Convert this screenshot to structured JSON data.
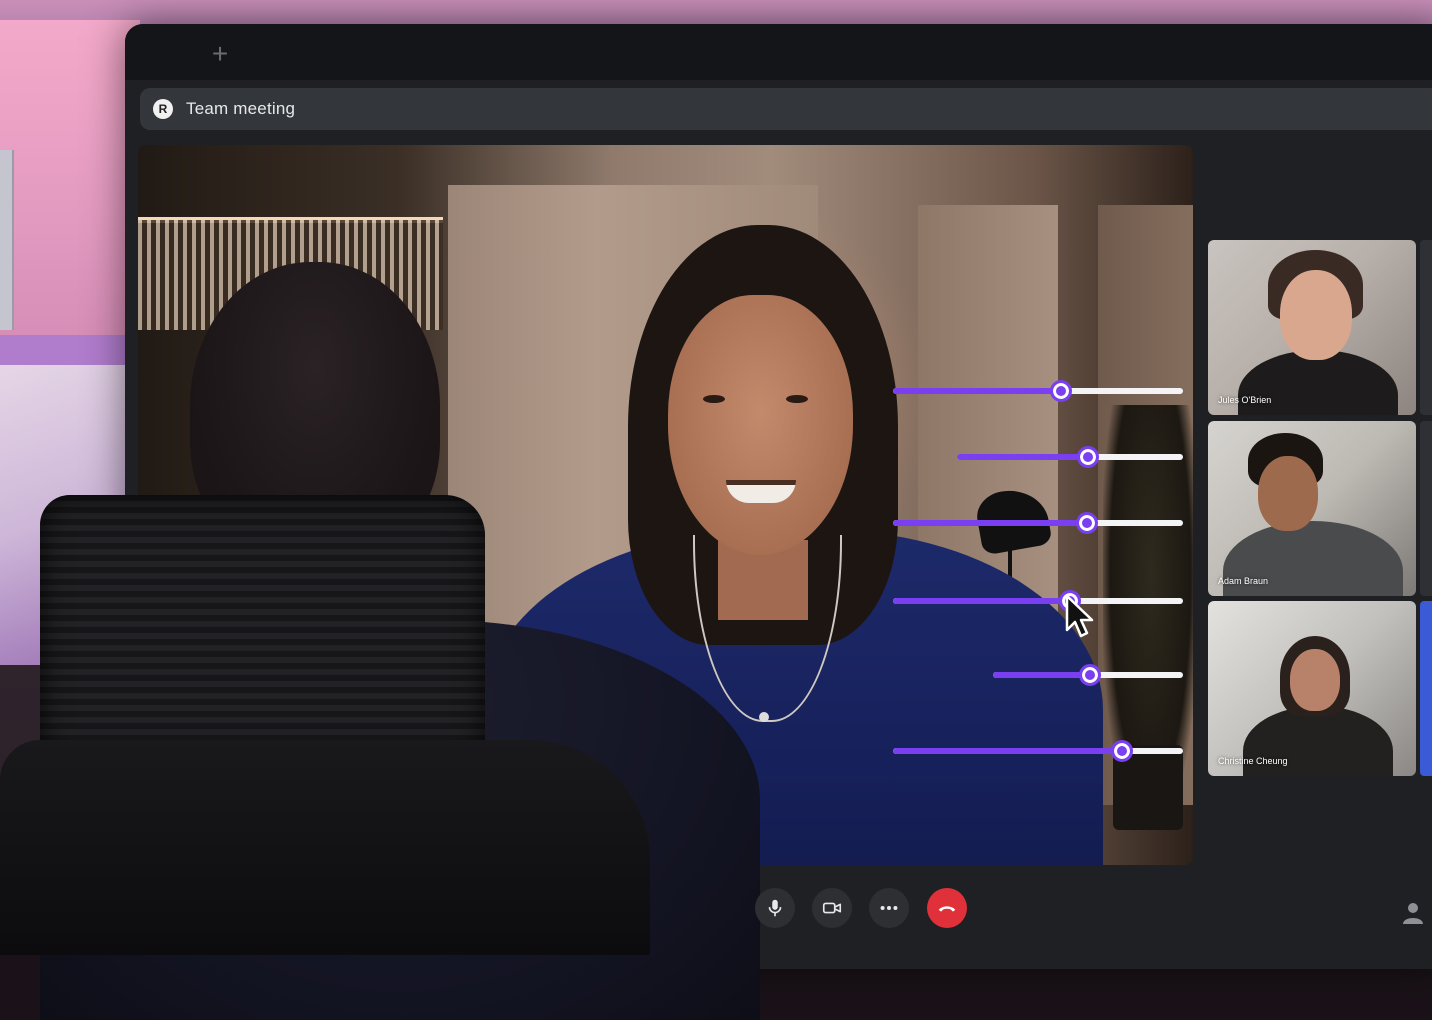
{
  "window": {
    "meeting_title": "Team meeting",
    "avatar_initial": "R",
    "new_tab_glyph": "+"
  },
  "participants": [
    {
      "name": "Jules O'Brien"
    },
    {
      "name": "Adam Braun"
    },
    {
      "name": "Christine Cheung"
    }
  ],
  "sliders": [
    {
      "value_fraction": 0.58
    },
    {
      "value_fraction": 0.58
    },
    {
      "value_fraction": 0.67
    },
    {
      "value_fraction": 0.61
    },
    {
      "value_fraction": 0.51
    },
    {
      "value_fraction": 0.79
    }
  ],
  "controls": [
    {
      "icon": "microphone-icon"
    },
    {
      "icon": "camera-icon"
    },
    {
      "icon": "more-options-icon"
    },
    {
      "icon": "end-call-icon"
    }
  ],
  "colors": {
    "slider_accent": "#7a3ff0",
    "end_call": "#e0313b",
    "title_bar": "#33363a"
  }
}
